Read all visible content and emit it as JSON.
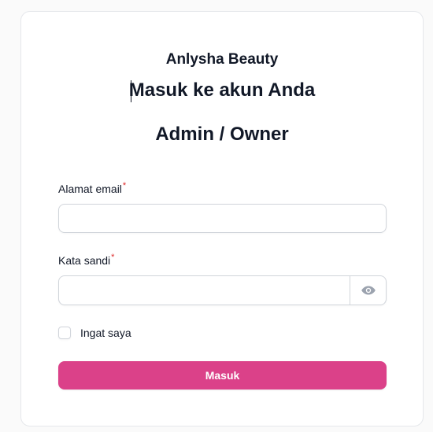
{
  "brand": {
    "name": "Anlysha Beauty"
  },
  "form": {
    "heading": "Masuk ke akun Anda",
    "subheading": "Admin / Owner",
    "email": {
      "label": "Alamat email",
      "required_mark": "*",
      "value": "",
      "placeholder": ""
    },
    "password": {
      "label": "Kata sandi",
      "required_mark": "*",
      "value": "",
      "placeholder": "",
      "toggle_icon": "eye-icon"
    },
    "remember": {
      "label": "Ingat saya",
      "checked": false
    },
    "submit_label": "Masuk"
  },
  "colors": {
    "accent": "#db4189",
    "required": "#dc2626",
    "border": "#d1d5db"
  }
}
